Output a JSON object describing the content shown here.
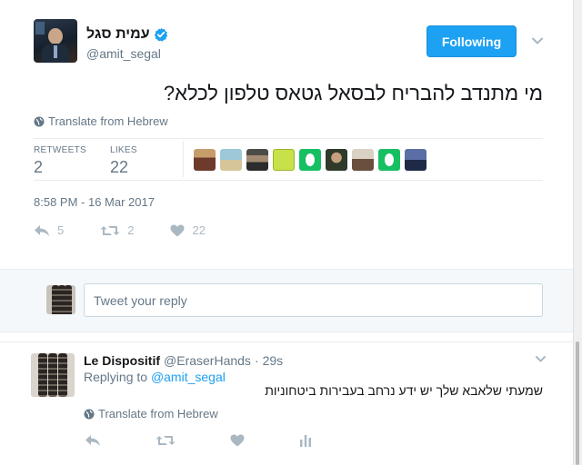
{
  "tweet": {
    "display_name": "עמית סגל",
    "handle": "@amit_segal",
    "follow_label": "Following",
    "text": "מי מתנדב להבריח לבסאל גטאס טלפון לכלא?",
    "translate_label": "Translate from Hebrew",
    "stats": {
      "retweets_label": "RETWEETS",
      "retweets_value": "2",
      "likes_label": "LIKES",
      "likes_value": "22"
    },
    "timestamp": "8:58 PM - 16 Mar 2017",
    "actions": {
      "reply_count": "5",
      "retweet_count": "2",
      "like_count": "22"
    }
  },
  "reply_box": {
    "placeholder": "Tweet your reply"
  },
  "reply": {
    "name": "Le Dispositif",
    "handle": "@EraserHands",
    "dot": "·",
    "time": "29s",
    "replying_label": "Replying to",
    "replying_to": "@amit_segal",
    "text": "שמעתי שלאבא שלך יש ידע נרחב בעבירות ביטחוניות",
    "translate_label": "Translate from Hebrew"
  },
  "colors": {
    "accent": "#1da1f2",
    "muted": "#657786",
    "icon_gray": "#aab8c2",
    "egg_green": "#17bf63"
  }
}
